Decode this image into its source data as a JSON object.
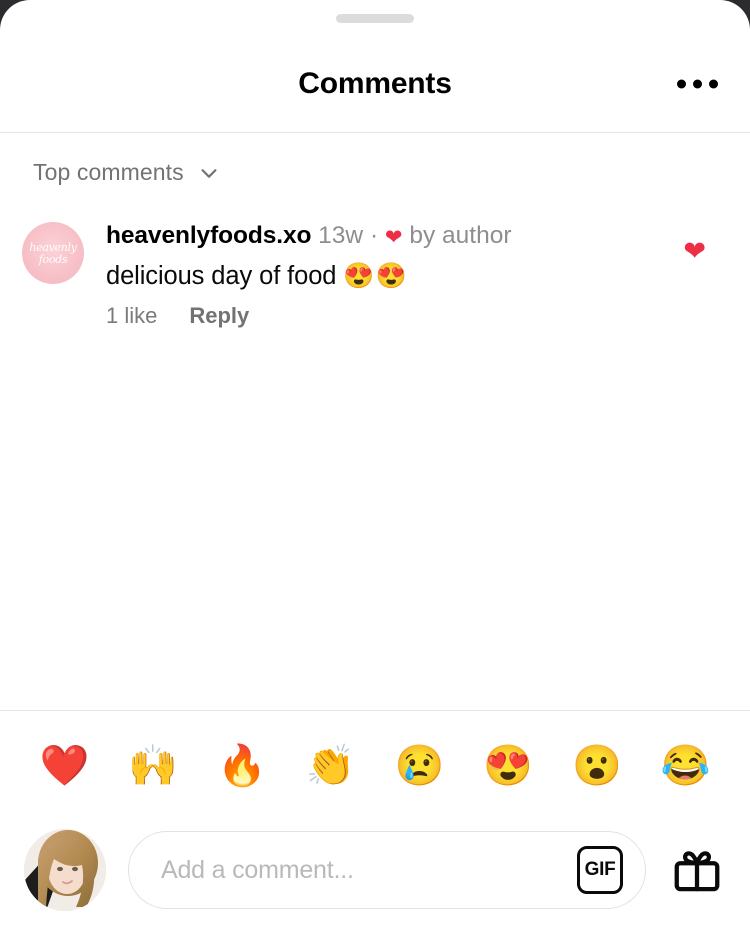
{
  "sheet": {
    "drag_handle": "drag-handle",
    "corner_radius_px": 30,
    "background": "#ffffff"
  },
  "header": {
    "title": "Comments",
    "more_icon": "more-horizontal-icon"
  },
  "sort": {
    "label": "Top comments",
    "chevron_icon": "chevron-down-icon"
  },
  "comments": [
    {
      "avatar": {
        "type": "brand-logo",
        "line1": "heavenly",
        "line2": "foods",
        "background": "#f6bdc5"
      },
      "username": "heavenlyfoods.xo",
      "time": "13w",
      "separator": "·",
      "liked_by_author_icon": "heart-filled-icon",
      "liked_by_author_label": "by author",
      "text": "delicious day of food",
      "text_emoji": "😍😍",
      "likes_label": "1 like",
      "reply_label": "Reply",
      "like_button_icon": "heart-filled-icon",
      "like_button_active": true,
      "like_color": "#ed2e45"
    }
  ],
  "emoji_bar": {
    "items": [
      {
        "name": "emoji-red-heart",
        "glyph": "❤️"
      },
      {
        "name": "emoji-raising-hands",
        "glyph": "🙌"
      },
      {
        "name": "emoji-fire",
        "glyph": "🔥"
      },
      {
        "name": "emoji-clapping-hands",
        "glyph": "👏"
      },
      {
        "name": "emoji-crying-face",
        "glyph": "😢"
      },
      {
        "name": "emoji-smiling-face-with-heart-eyes",
        "glyph": "😍"
      },
      {
        "name": "emoji-face-with-open-mouth",
        "glyph": "😮"
      },
      {
        "name": "emoji-face-with-tears-of-joy",
        "glyph": "😂"
      }
    ]
  },
  "composer": {
    "avatar_name": "current-user-avatar",
    "placeholder": "Add a comment...",
    "value": "",
    "gif_label": "GIF",
    "gift_icon": "gift-icon"
  },
  "colors": {
    "accent_like": "#ed2e45",
    "text_primary": "#0a0a0a",
    "text_secondary": "#737373",
    "placeholder": "#b9b9b9",
    "divider": "#e6e6e6",
    "handle": "#dcdcdc"
  }
}
